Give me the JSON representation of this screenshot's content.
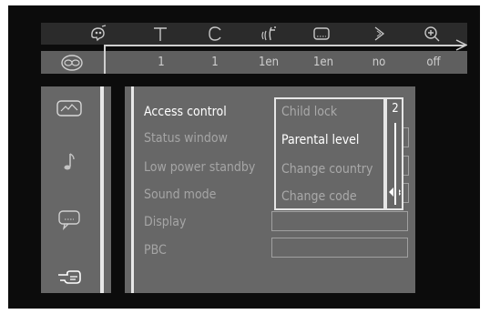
{
  "top_bar": {
    "icons": [
      "camera-angle-icon",
      "subtitle-icon",
      "chapter-icon",
      "audio-language-icon",
      "subtitle-box-icon",
      "slow-motion-icon",
      "zoom-icon"
    ],
    "values": [
      "1",
      "1",
      "1en",
      "1en",
      "no",
      "off"
    ]
  },
  "left_menu": {
    "icons": [
      "picture-icon",
      "music-note-icon",
      "speech-bubble-icon",
      "hand-pointer-icon"
    ]
  },
  "settings": {
    "items": [
      "Access control",
      "Status window",
      "Low power standby",
      "Sound mode",
      "Display",
      "PBC"
    ]
  },
  "access_control_popup": {
    "options": [
      "Child lock",
      "Parental level",
      "Change country",
      "Change code"
    ],
    "selected": "Parental level",
    "level_value": "2"
  },
  "colors": {
    "background": "#0c0c0c",
    "panel": "#676767",
    "active_text": "#ffffff",
    "inactive_text": "#a5a5a5"
  }
}
